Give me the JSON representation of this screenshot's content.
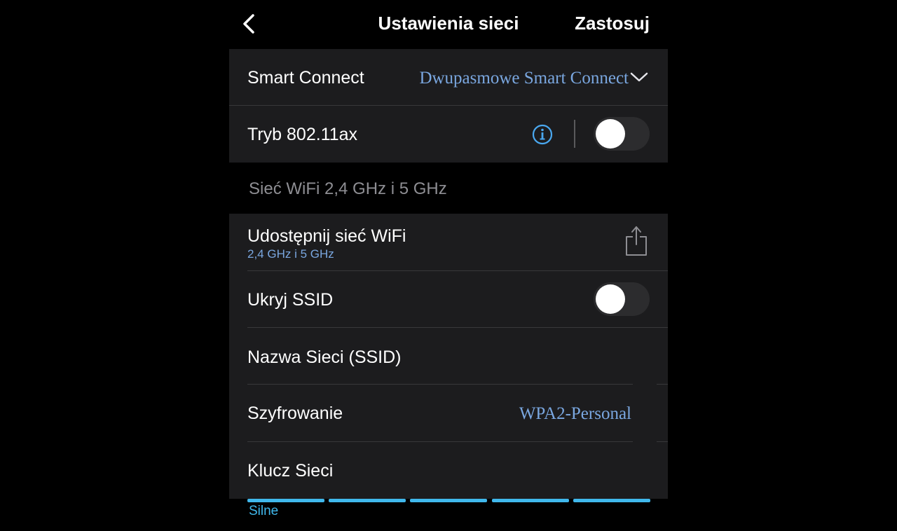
{
  "navbar": {
    "title": "Ustawienia sieci",
    "apply_label": "Zastosuj",
    "back_icon": "chevron-left-icon"
  },
  "smart_connect": {
    "label": "Smart Connect",
    "value": "Dwupasmowe Smart Connect"
  },
  "ax_mode": {
    "label": "Tryb 802.11ax",
    "enabled": false
  },
  "section_header": "Sieć WiFi 2,4 GHz i 5 GHz",
  "share_wifi": {
    "label": "Udostępnij sieć WiFi",
    "sublabel": "2,4 GHz i 5 GHz"
  },
  "hide_ssid": {
    "label": "Ukryj SSID",
    "enabled": false
  },
  "ssid": {
    "label": "Nazwa Sieci (SSID)",
    "value": ""
  },
  "encryption": {
    "label": "Szyfrowanie",
    "value": "WPA2-Personal"
  },
  "network_key": {
    "label": "Klucz Sieci",
    "value": ""
  },
  "password_strength": {
    "label": "Silne",
    "level": 5,
    "max_level": 5
  },
  "colors": {
    "accent_blue": "#7aa7e0",
    "strength_blue": "#40b8ec",
    "card_bg": "#1c1c1e",
    "background": "#000000"
  }
}
